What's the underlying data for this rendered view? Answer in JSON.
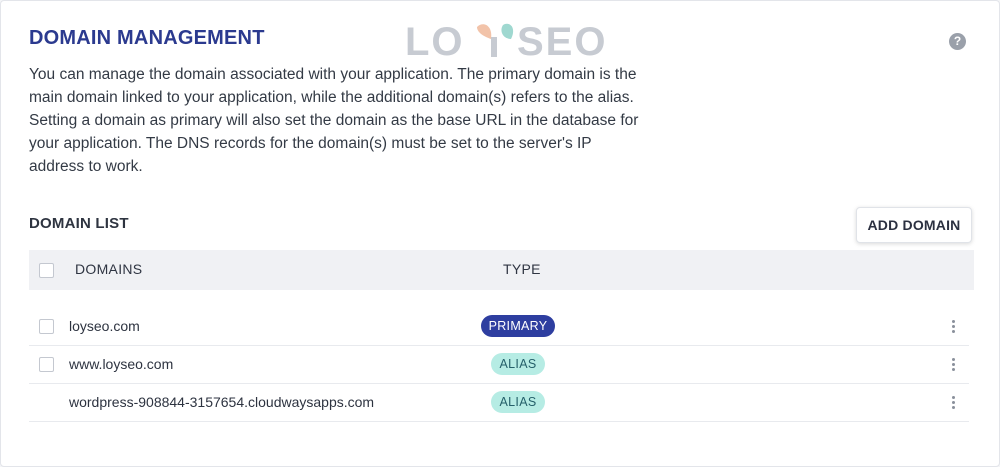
{
  "header": {
    "title": "DOMAIN MANAGEMENT",
    "help_icon": "question-circle-icon",
    "watermark": "LOYSEO"
  },
  "description": "You can manage the domain associated with your application. The primary domain is the main domain linked to your application, while the additional domain(s) refers to the alias. Setting a domain as primary will also set the domain as the base URL in the database for your application. The DNS records for the domain(s) must be set to the server's IP address to work.",
  "domain_list": {
    "title": "DOMAIN LIST",
    "add_button": "ADD DOMAIN",
    "columns": {
      "domains": "DOMAINS",
      "type": "TYPE"
    },
    "rows": [
      {
        "domain": "loyseo.com",
        "type": "PRIMARY",
        "has_checkbox": true
      },
      {
        "domain": "www.loyseo.com",
        "type": "ALIAS",
        "has_checkbox": true
      },
      {
        "domain": "wordpress-908844-3157654.cloudwaysapps.com",
        "type": "ALIAS",
        "has_checkbox": false
      }
    ]
  },
  "colors": {
    "title": "#2b3a8f",
    "primary_badge": "#2e3ea0",
    "alias_badge": "#b6ece4",
    "watermark": "#c7cbd2",
    "watermark_leaf_left": "#f2c3a9",
    "watermark_leaf_right": "#9fd8d0"
  }
}
